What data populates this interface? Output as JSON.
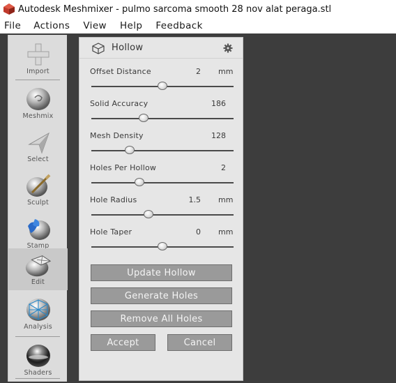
{
  "window": {
    "title": "Autodesk Meshmixer - pulmo sarcoma smooth 28 nov alat peraga.stl",
    "icon": "meshmixer-app-icon"
  },
  "menu": [
    "File",
    "Actions",
    "View",
    "Help",
    "Feedback"
  ],
  "tools": [
    {
      "label": "Import",
      "icon": "plus-icon"
    },
    {
      "label": "Meshmix",
      "icon": "meshmix-sphere-icon"
    },
    {
      "label": "Select",
      "icon": "arrow-pointer-icon"
    },
    {
      "label": "Sculpt",
      "icon": "brush-sphere-icon"
    },
    {
      "label": "Stamp",
      "icon": "stamp-sphere-icon"
    },
    {
      "label": "Edit",
      "icon": "edit-sphere-icon",
      "active": true
    },
    {
      "label": "Analysis",
      "icon": "analysis-sphere-icon"
    },
    {
      "label": "Shaders",
      "icon": "shader-sphere-icon"
    }
  ],
  "panel": {
    "title": "Hollow",
    "title_icon": "cube-outline-icon",
    "settings_icon": "gear-icon",
    "params": [
      {
        "label": "Offset Distance",
        "value": "2",
        "unit": "mm",
        "slider": 0.5
      },
      {
        "label": "Solid Accuracy",
        "value": "186",
        "unit": "",
        "slider": 0.37
      },
      {
        "label": "Mesh Density",
        "value": "128",
        "unit": "",
        "slider": 0.27
      },
      {
        "label": "Holes Per Hollow",
        "value": "2",
        "unit": "",
        "slider": 0.34
      },
      {
        "label": "Hole Radius",
        "value": "1.5",
        "unit": "mm",
        "slider": 0.4
      },
      {
        "label": "Hole Taper",
        "value": "0",
        "unit": "mm",
        "slider": 0.5
      }
    ],
    "buttons": {
      "update": "Update Hollow",
      "generate": "Generate Holes",
      "remove": "Remove All Holes",
      "accept": "Accept",
      "cancel": "Cancel"
    }
  },
  "colors": {
    "viewport": "#3d3d3d",
    "panel": "#e6e6e6",
    "button": "#9a9a9a"
  }
}
